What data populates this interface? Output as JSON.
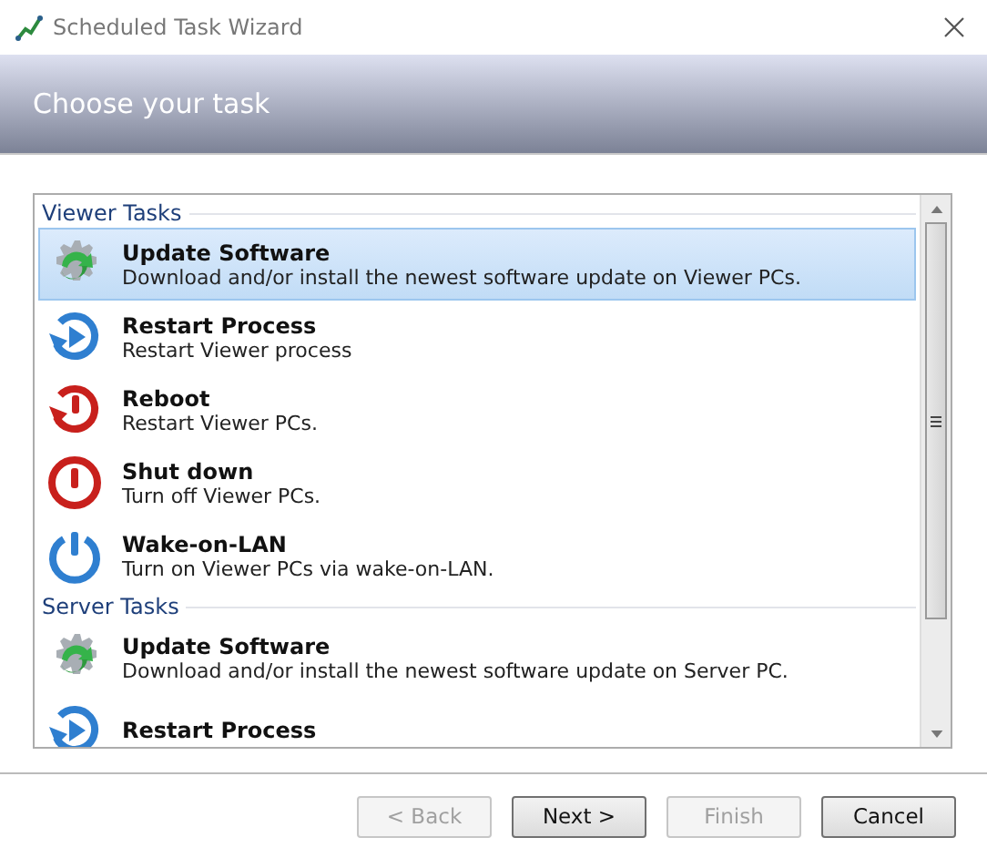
{
  "window": {
    "title": "Scheduled Task Wizard"
  },
  "header": {
    "title": "Choose your task"
  },
  "groups": [
    {
      "label": "Viewer Tasks",
      "items": [
        {
          "kind": "update",
          "title": "Update Software",
          "description": "Download and/or install the newest software update on Viewer PCs.",
          "selected": true
        },
        {
          "kind": "restart",
          "title": "Restart Process",
          "description": "Restart Viewer process",
          "selected": false
        },
        {
          "kind": "reboot",
          "title": "Reboot",
          "description": "Restart Viewer PCs.",
          "selected": false
        },
        {
          "kind": "shutdown",
          "title": "Shut down",
          "description": "Turn off Viewer PCs.",
          "selected": false
        },
        {
          "kind": "wake",
          "title": "Wake-on-LAN",
          "description": "Turn on Viewer PCs via wake-on-LAN.",
          "selected": false
        }
      ]
    },
    {
      "label": "Server Tasks",
      "items": [
        {
          "kind": "update",
          "title": "Update Software",
          "description": "Download and/or install the newest software update on Server PC.",
          "selected": false
        },
        {
          "kind": "restart",
          "title": "Restart Process",
          "selected": false
        }
      ]
    }
  ],
  "buttons": [
    {
      "label": "< Back",
      "disabled": true
    },
    {
      "label": "Next >",
      "disabled": false
    },
    {
      "label": "Finish",
      "disabled": true
    },
    {
      "label": "Cancel",
      "disabled": false
    }
  ]
}
